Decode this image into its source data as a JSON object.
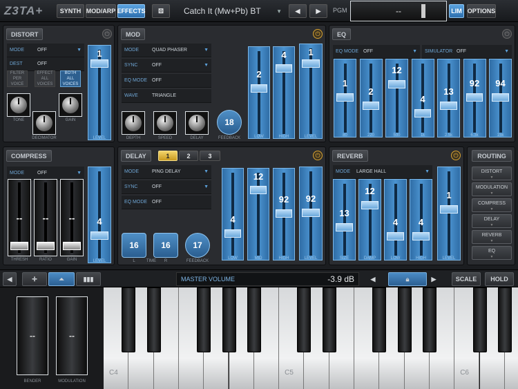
{
  "app": {
    "logo": "Z3TA+"
  },
  "topbar": {
    "tabs": [
      {
        "label": "SYNTH"
      },
      {
        "label": "MOD/ARP"
      },
      {
        "label": "EFFECTS"
      }
    ],
    "preset_name": "Catch It (Mw+Pb) BT",
    "pgm_label": "PGM",
    "pgm_value": "--",
    "lim_label": "LIM",
    "options_label": "OPTIONS"
  },
  "distort": {
    "title": "DISTORT",
    "mode": {
      "key": "MODE",
      "value": "OFF"
    },
    "dest": {
      "key": "DEST",
      "value": "OFF"
    },
    "buttons": [
      {
        "l1": "FILTER",
        "l2": "PER",
        "l3": "VOICE"
      },
      {
        "l1": "EFFECT",
        "l2": "ALL",
        "l3": "VOICES"
      },
      {
        "l1": "BOTH",
        "l2": "ALL",
        "l3": "VOICES"
      }
    ],
    "knobs": [
      {
        "label": "TONE"
      },
      {
        "label": "DECIMATOR"
      },
      {
        "label": "GAIN"
      }
    ],
    "level": {
      "value": "1",
      "label": "LEVEL",
      "position": 0.9
    }
  },
  "mod": {
    "title": "MOD",
    "rows": [
      {
        "key": "MODE",
        "value": "QUAD PHASER"
      },
      {
        "key": "SYNC",
        "value": "OFF"
      },
      {
        "key": "EQ MODE",
        "value": "OFF"
      },
      {
        "key": "WAVE",
        "value": "TRIANGLE"
      }
    ],
    "knobs": [
      {
        "label": "DEPTH"
      },
      {
        "label": "SPEED"
      },
      {
        "label": "DELAY"
      }
    ],
    "feedback": {
      "value": "18",
      "label": "FEEDBACK"
    },
    "sliders": [
      {
        "value": "2",
        "label": "LOW",
        "position": 0.55
      },
      {
        "value": "4",
        "label": "HIGH",
        "position": 0.85
      }
    ],
    "level": {
      "value": "1",
      "label": "LEVEL",
      "position": 0.88
    }
  },
  "eq": {
    "title": "EQ",
    "eq_mode": {
      "key": "EQ MODE",
      "value": "OFF"
    },
    "simulator": {
      "key": "SIMULATOR",
      "value": "OFF"
    },
    "bands": [
      {
        "value": "1",
        "label": "80",
        "position": 0.5
      },
      {
        "value": "2",
        "label": "220",
        "position": 0.35
      },
      {
        "value": "12",
        "label": "500",
        "position": 0.75
      },
      {
        "value": "4",
        "label": "1k",
        "position": 0.2
      },
      {
        "value": "13",
        "label": "2.5k",
        "position": 0.35
      },
      {
        "value": "92",
        "label": "6.3k",
        "position": 0.5
      },
      {
        "value": "94",
        "label": "15k",
        "position": 0.5
      }
    ]
  },
  "compress": {
    "title": "COMPRESS",
    "mode": {
      "key": "MODE",
      "value": "OFF"
    },
    "sliders": [
      {
        "value": "--",
        "label": "THRESH"
      },
      {
        "value": "--",
        "label": "RATIO"
      },
      {
        "value": "--",
        "label": "GAIN"
      }
    ],
    "level": {
      "value": "4",
      "label": "LEVEL",
      "position": 0.2
    }
  },
  "delay": {
    "title": "DELAY",
    "pages": [
      "1",
      "2",
      "3"
    ],
    "rows": [
      {
        "key": "MODE",
        "value": "PING DELAY"
      },
      {
        "key": "SYNC",
        "value": "OFF"
      },
      {
        "key": "EQ MODE",
        "value": "OFF"
      }
    ],
    "knobs": [
      {
        "value": "16",
        "label": "L"
      },
      {
        "value": "16",
        "label": "R"
      },
      {
        "value": "17",
        "label": "FEEDBACK"
      }
    ],
    "time_label": "TIME",
    "sliders": [
      {
        "value": "4",
        "label": "LOW",
        "position": 0.2
      },
      {
        "value": "12",
        "label": "MID",
        "position": 0.85
      },
      {
        "value": "92",
        "label": "HIGH",
        "position": 0.5
      }
    ],
    "level": {
      "value": "92",
      "label": "LEVEL",
      "position": 0.5
    }
  },
  "reverb": {
    "title": "REVERB",
    "mode": {
      "key": "MODE",
      "value": "LARGE HALL"
    },
    "sliders": [
      {
        "value": "13",
        "label": "SIZE",
        "position": 0.35
      },
      {
        "value": "12",
        "label": "DAMP",
        "position": 0.75
      },
      {
        "value": "4",
        "label": "LOW",
        "position": 0.2
      },
      {
        "value": "4",
        "label": "HIGH",
        "position": 0.2
      }
    ],
    "level": {
      "value": "1",
      "label": "LEVEL",
      "position": 0.55
    }
  },
  "routing": {
    "title": "ROUTING",
    "items": [
      "DISTORT",
      "MODULATION",
      "COMPRESS",
      "DELAY",
      "REVERB",
      "EQ"
    ]
  },
  "bottom": {
    "master_label": "MASTER VOLUME",
    "master_value": "-3.9",
    "master_unit": "dB",
    "scale_label": "SCALE",
    "hold_label": "HOLD"
  },
  "wheels": [
    {
      "value": "--",
      "label": "BENDER"
    },
    {
      "value": "--",
      "label": "MODULATION"
    }
  ],
  "keyboard": {
    "notes": [
      "C4",
      "C5",
      "C6"
    ]
  }
}
